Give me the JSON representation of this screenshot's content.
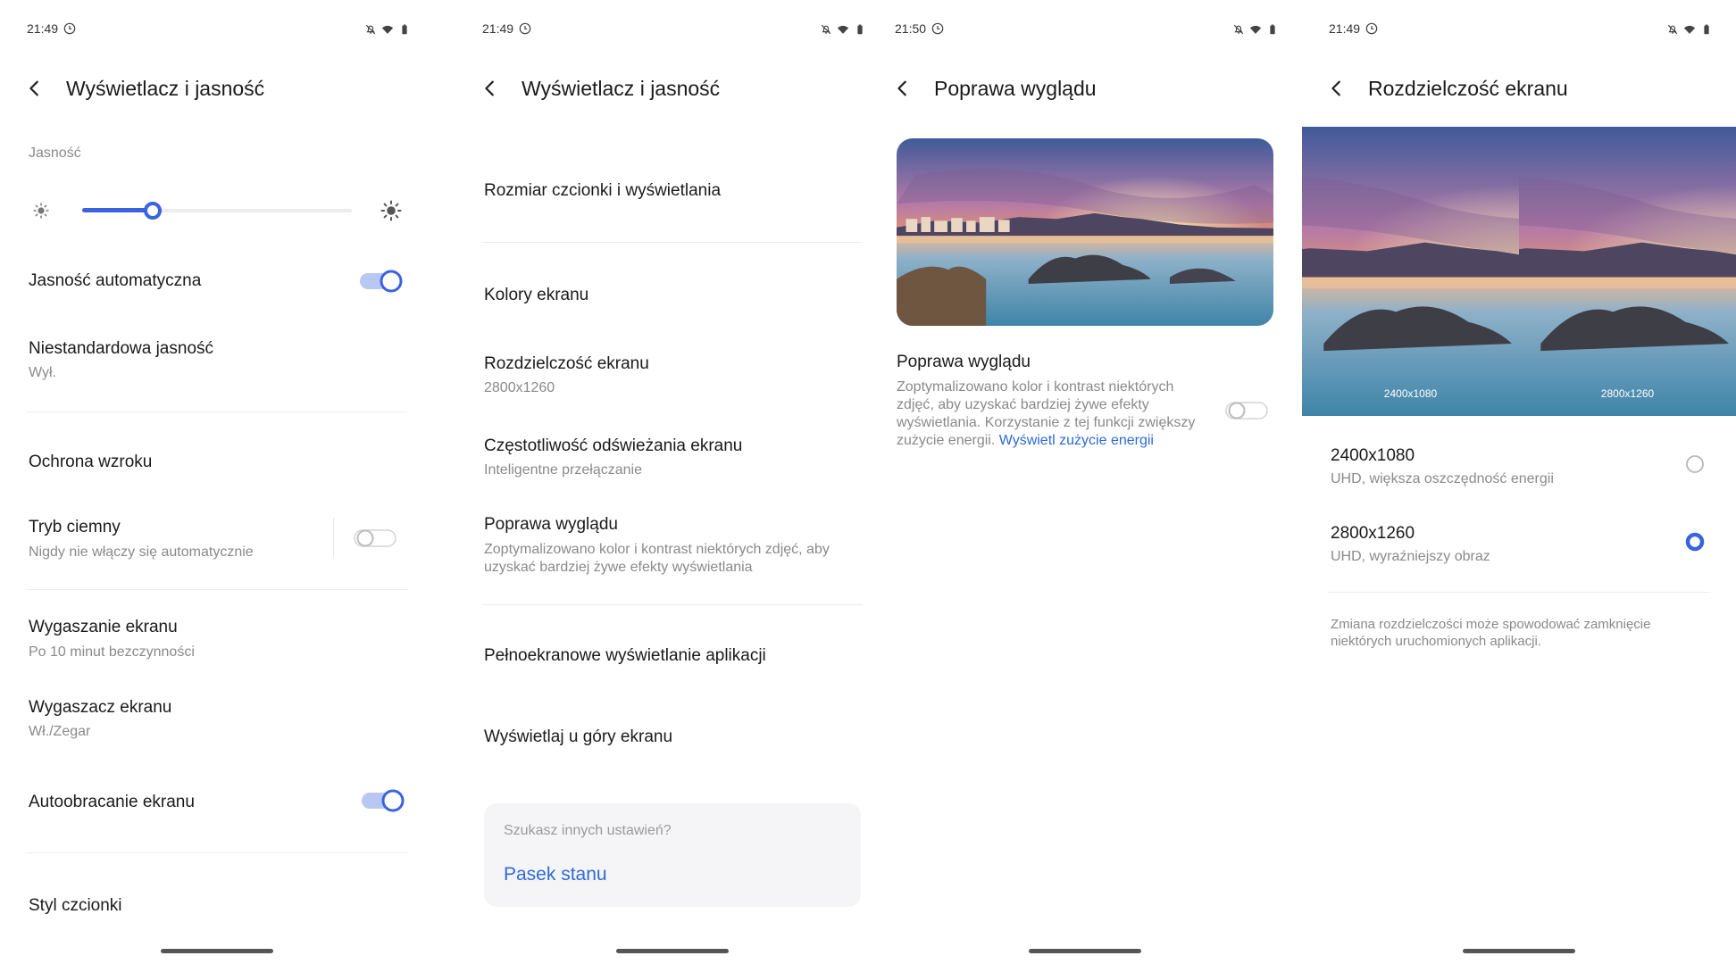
{
  "screen1": {
    "status_time": "21:49",
    "title": "Wyświetlacz i jasność",
    "brightness_label": "Jasność",
    "brightness_level": 0.26,
    "auto_brightness": "Jasność automatyczna",
    "auto_brightness_on": true,
    "custom_brightness": "Niestandardowa jasność",
    "custom_brightness_value": "Wył.",
    "eye_protection": "Ochrona wzroku",
    "dark_mode": "Tryb ciemny",
    "dark_mode_sub": "Nigdy nie włączy się automatycznie",
    "dark_mode_on": false,
    "screen_timeout": "Wygaszanie ekranu",
    "screen_timeout_sub": "Po 10 minut bezczynności",
    "screensaver": "Wygaszacz ekranu",
    "screensaver_sub": "Wł./Zegar",
    "auto_rotate": "Autoobracanie ekranu",
    "auto_rotate_on": true,
    "font_style": "Styl czcionki"
  },
  "screen2": {
    "status_time": "21:49",
    "title": "Wyświetlacz i jasność",
    "font_size": "Rozmiar czcionki i wyświetlania",
    "screen_colors": "Kolory ekranu",
    "resolution": "Rozdzielczość ekranu",
    "resolution_value": "2800x1260",
    "refresh_rate": "Częstotliwość odświeżania ekranu",
    "refresh_rate_value": "Inteligentne przełączanie",
    "enhance": "Poprawa wyglądu",
    "enhance_sub": "Zoptymalizowano kolor i kontrast niektórych zdjęć, aby uzyskać bardziej żywe efekty wyświetlania",
    "fullscreen_apps": "Pełnoekranowe wyświetlanie aplikacji",
    "show_top": "Wyświetlaj u góry ekranu",
    "search_hint": "Szukasz innych ustawień?",
    "status_bar_link": "Pasek stanu"
  },
  "screen3": {
    "status_time": "21:50",
    "title": "Poprawa wyglądu",
    "item_title": "Poprawa wyglądu",
    "item_desc": "Zoptymalizowano kolor i kontrast niektórych zdjęć, aby uzyskać bardziej żywe efekty wyświetlania. Korzystanie z tej funkcji zwiększy zużycie energii.",
    "item_link": "Wyświetl zużycie energii",
    "toggle_on": false
  },
  "screen4": {
    "status_time": "21:49",
    "title": "Rozdzielczość ekranu",
    "preview_left_label": "2400x1080",
    "preview_right_label": "2800x1260",
    "option1_title": "2400x1080",
    "option1_sub": "UHD, większa oszczędność energii",
    "option2_title": "2800x1260",
    "option2_sub": "UHD, wyraźniejszy obraz",
    "selected": 2,
    "note": "Zmiana rozdzielczości może spowodować zamknięcie niektórych uruchomionych aplikacji."
  },
  "colors": {
    "accent": "#3a63e0",
    "link": "#2c6ad9",
    "text": "#1a1a1a",
    "secondary": "#8a8a8a"
  }
}
